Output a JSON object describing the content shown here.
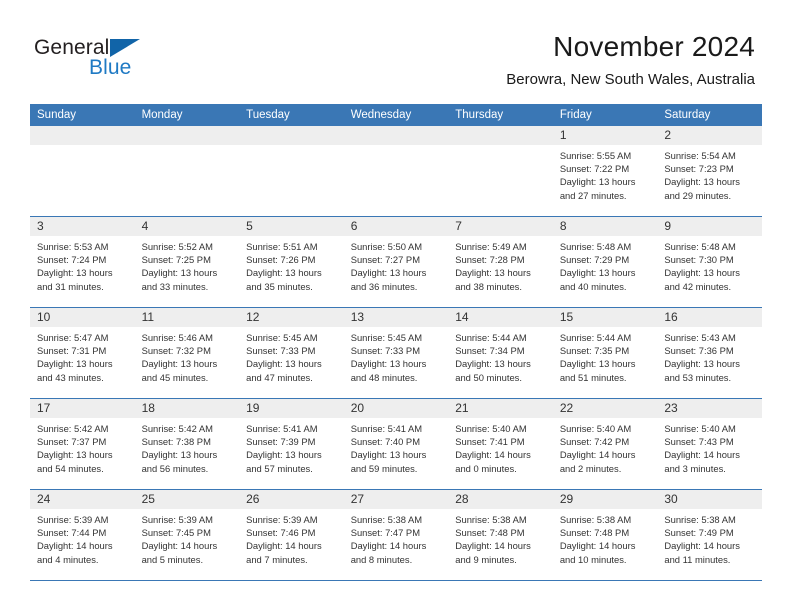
{
  "brand": {
    "name_part1": "General",
    "name_part2": "Blue",
    "triangle_color": "#1164a8",
    "blue_color": "#1f7ac4"
  },
  "header": {
    "title": "November 2024",
    "subtitle": "Berowra, New South Wales, Australia"
  },
  "theme": {
    "header_blue": "#3a77b5",
    "day_strip_gray": "#eeeeee",
    "text_color": "#333333"
  },
  "weekdays": [
    "Sunday",
    "Monday",
    "Tuesday",
    "Wednesday",
    "Thursday",
    "Friday",
    "Saturday"
  ],
  "labels": {
    "sunrise_prefix": "Sunrise: ",
    "sunset_prefix": "Sunset: ",
    "daylight_prefix": "Daylight: "
  },
  "weeks": [
    [
      {
        "day": "",
        "empty": true
      },
      {
        "day": "",
        "empty": true
      },
      {
        "day": "",
        "empty": true
      },
      {
        "day": "",
        "empty": true
      },
      {
        "day": "",
        "empty": true
      },
      {
        "day": "1",
        "sunrise": "Sunrise: 5:55 AM",
        "sunset": "Sunset: 7:22 PM",
        "daylight": "Daylight: 13 hours and 27 minutes."
      },
      {
        "day": "2",
        "sunrise": "Sunrise: 5:54 AM",
        "sunset": "Sunset: 7:23 PM",
        "daylight": "Daylight: 13 hours and 29 minutes."
      }
    ],
    [
      {
        "day": "3",
        "sunrise": "Sunrise: 5:53 AM",
        "sunset": "Sunset: 7:24 PM",
        "daylight": "Daylight: 13 hours and 31 minutes."
      },
      {
        "day": "4",
        "sunrise": "Sunrise: 5:52 AM",
        "sunset": "Sunset: 7:25 PM",
        "daylight": "Daylight: 13 hours and 33 minutes."
      },
      {
        "day": "5",
        "sunrise": "Sunrise: 5:51 AM",
        "sunset": "Sunset: 7:26 PM",
        "daylight": "Daylight: 13 hours and 35 minutes."
      },
      {
        "day": "6",
        "sunrise": "Sunrise: 5:50 AM",
        "sunset": "Sunset: 7:27 PM",
        "daylight": "Daylight: 13 hours and 36 minutes."
      },
      {
        "day": "7",
        "sunrise": "Sunrise: 5:49 AM",
        "sunset": "Sunset: 7:28 PM",
        "daylight": "Daylight: 13 hours and 38 minutes."
      },
      {
        "day": "8",
        "sunrise": "Sunrise: 5:48 AM",
        "sunset": "Sunset: 7:29 PM",
        "daylight": "Daylight: 13 hours and 40 minutes."
      },
      {
        "day": "9",
        "sunrise": "Sunrise: 5:48 AM",
        "sunset": "Sunset: 7:30 PM",
        "daylight": "Daylight: 13 hours and 42 minutes."
      }
    ],
    [
      {
        "day": "10",
        "sunrise": "Sunrise: 5:47 AM",
        "sunset": "Sunset: 7:31 PM",
        "daylight": "Daylight: 13 hours and 43 minutes."
      },
      {
        "day": "11",
        "sunrise": "Sunrise: 5:46 AM",
        "sunset": "Sunset: 7:32 PM",
        "daylight": "Daylight: 13 hours and 45 minutes."
      },
      {
        "day": "12",
        "sunrise": "Sunrise: 5:45 AM",
        "sunset": "Sunset: 7:33 PM",
        "daylight": "Daylight: 13 hours and 47 minutes."
      },
      {
        "day": "13",
        "sunrise": "Sunrise: 5:45 AM",
        "sunset": "Sunset: 7:33 PM",
        "daylight": "Daylight: 13 hours and 48 minutes."
      },
      {
        "day": "14",
        "sunrise": "Sunrise: 5:44 AM",
        "sunset": "Sunset: 7:34 PM",
        "daylight": "Daylight: 13 hours and 50 minutes."
      },
      {
        "day": "15",
        "sunrise": "Sunrise: 5:44 AM",
        "sunset": "Sunset: 7:35 PM",
        "daylight": "Daylight: 13 hours and 51 minutes."
      },
      {
        "day": "16",
        "sunrise": "Sunrise: 5:43 AM",
        "sunset": "Sunset: 7:36 PM",
        "daylight": "Daylight: 13 hours and 53 minutes."
      }
    ],
    [
      {
        "day": "17",
        "sunrise": "Sunrise: 5:42 AM",
        "sunset": "Sunset: 7:37 PM",
        "daylight": "Daylight: 13 hours and 54 minutes."
      },
      {
        "day": "18",
        "sunrise": "Sunrise: 5:42 AM",
        "sunset": "Sunset: 7:38 PM",
        "daylight": "Daylight: 13 hours and 56 minutes."
      },
      {
        "day": "19",
        "sunrise": "Sunrise: 5:41 AM",
        "sunset": "Sunset: 7:39 PM",
        "daylight": "Daylight: 13 hours and 57 minutes."
      },
      {
        "day": "20",
        "sunrise": "Sunrise: 5:41 AM",
        "sunset": "Sunset: 7:40 PM",
        "daylight": "Daylight: 13 hours and 59 minutes."
      },
      {
        "day": "21",
        "sunrise": "Sunrise: 5:40 AM",
        "sunset": "Sunset: 7:41 PM",
        "daylight": "Daylight: 14 hours and 0 minutes."
      },
      {
        "day": "22",
        "sunrise": "Sunrise: 5:40 AM",
        "sunset": "Sunset: 7:42 PM",
        "daylight": "Daylight: 14 hours and 2 minutes."
      },
      {
        "day": "23",
        "sunrise": "Sunrise: 5:40 AM",
        "sunset": "Sunset: 7:43 PM",
        "daylight": "Daylight: 14 hours and 3 minutes."
      }
    ],
    [
      {
        "day": "24",
        "sunrise": "Sunrise: 5:39 AM",
        "sunset": "Sunset: 7:44 PM",
        "daylight": "Daylight: 14 hours and 4 minutes."
      },
      {
        "day": "25",
        "sunrise": "Sunrise: 5:39 AM",
        "sunset": "Sunset: 7:45 PM",
        "daylight": "Daylight: 14 hours and 5 minutes."
      },
      {
        "day": "26",
        "sunrise": "Sunrise: 5:39 AM",
        "sunset": "Sunset: 7:46 PM",
        "daylight": "Daylight: 14 hours and 7 minutes."
      },
      {
        "day": "27",
        "sunrise": "Sunrise: 5:38 AM",
        "sunset": "Sunset: 7:47 PM",
        "daylight": "Daylight: 14 hours and 8 minutes."
      },
      {
        "day": "28",
        "sunrise": "Sunrise: 5:38 AM",
        "sunset": "Sunset: 7:48 PM",
        "daylight": "Daylight: 14 hours and 9 minutes."
      },
      {
        "day": "29",
        "sunrise": "Sunrise: 5:38 AM",
        "sunset": "Sunset: 7:48 PM",
        "daylight": "Daylight: 14 hours and 10 minutes."
      },
      {
        "day": "30",
        "sunrise": "Sunrise: 5:38 AM",
        "sunset": "Sunset: 7:49 PM",
        "daylight": "Daylight: 14 hours and 11 minutes."
      }
    ]
  ]
}
